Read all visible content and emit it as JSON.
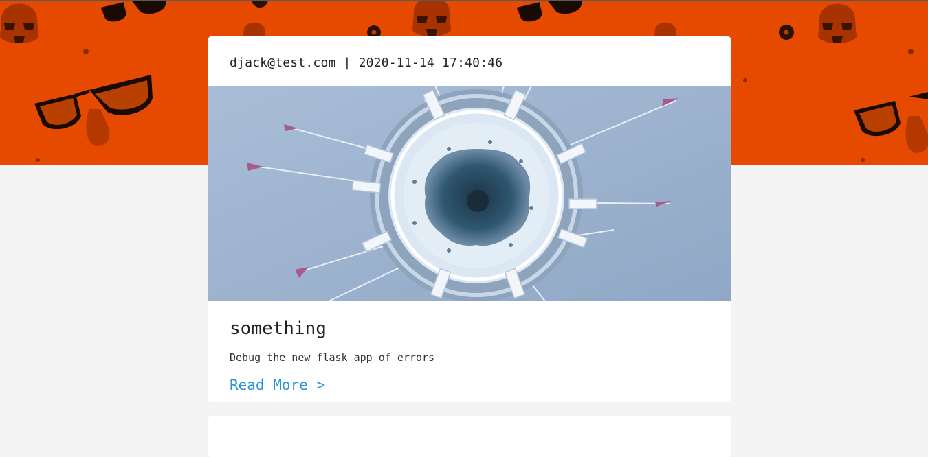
{
  "colors": {
    "banner_background": "#e64a00",
    "page_background": "#f4f4f4",
    "card_background": "#ffffff",
    "link": "#2a95d8"
  },
  "post": {
    "meta": "djack@test.com | 2020-11-14 17:40:46",
    "title": "something",
    "description": "Debug the new flask app of errors",
    "read_more": "Read More >"
  },
  "icons": {
    "banner_pattern": [
      "stormtrooper-helmet-icon",
      "sunglasses-nose-icon",
      "bomb-icon"
    ]
  }
}
